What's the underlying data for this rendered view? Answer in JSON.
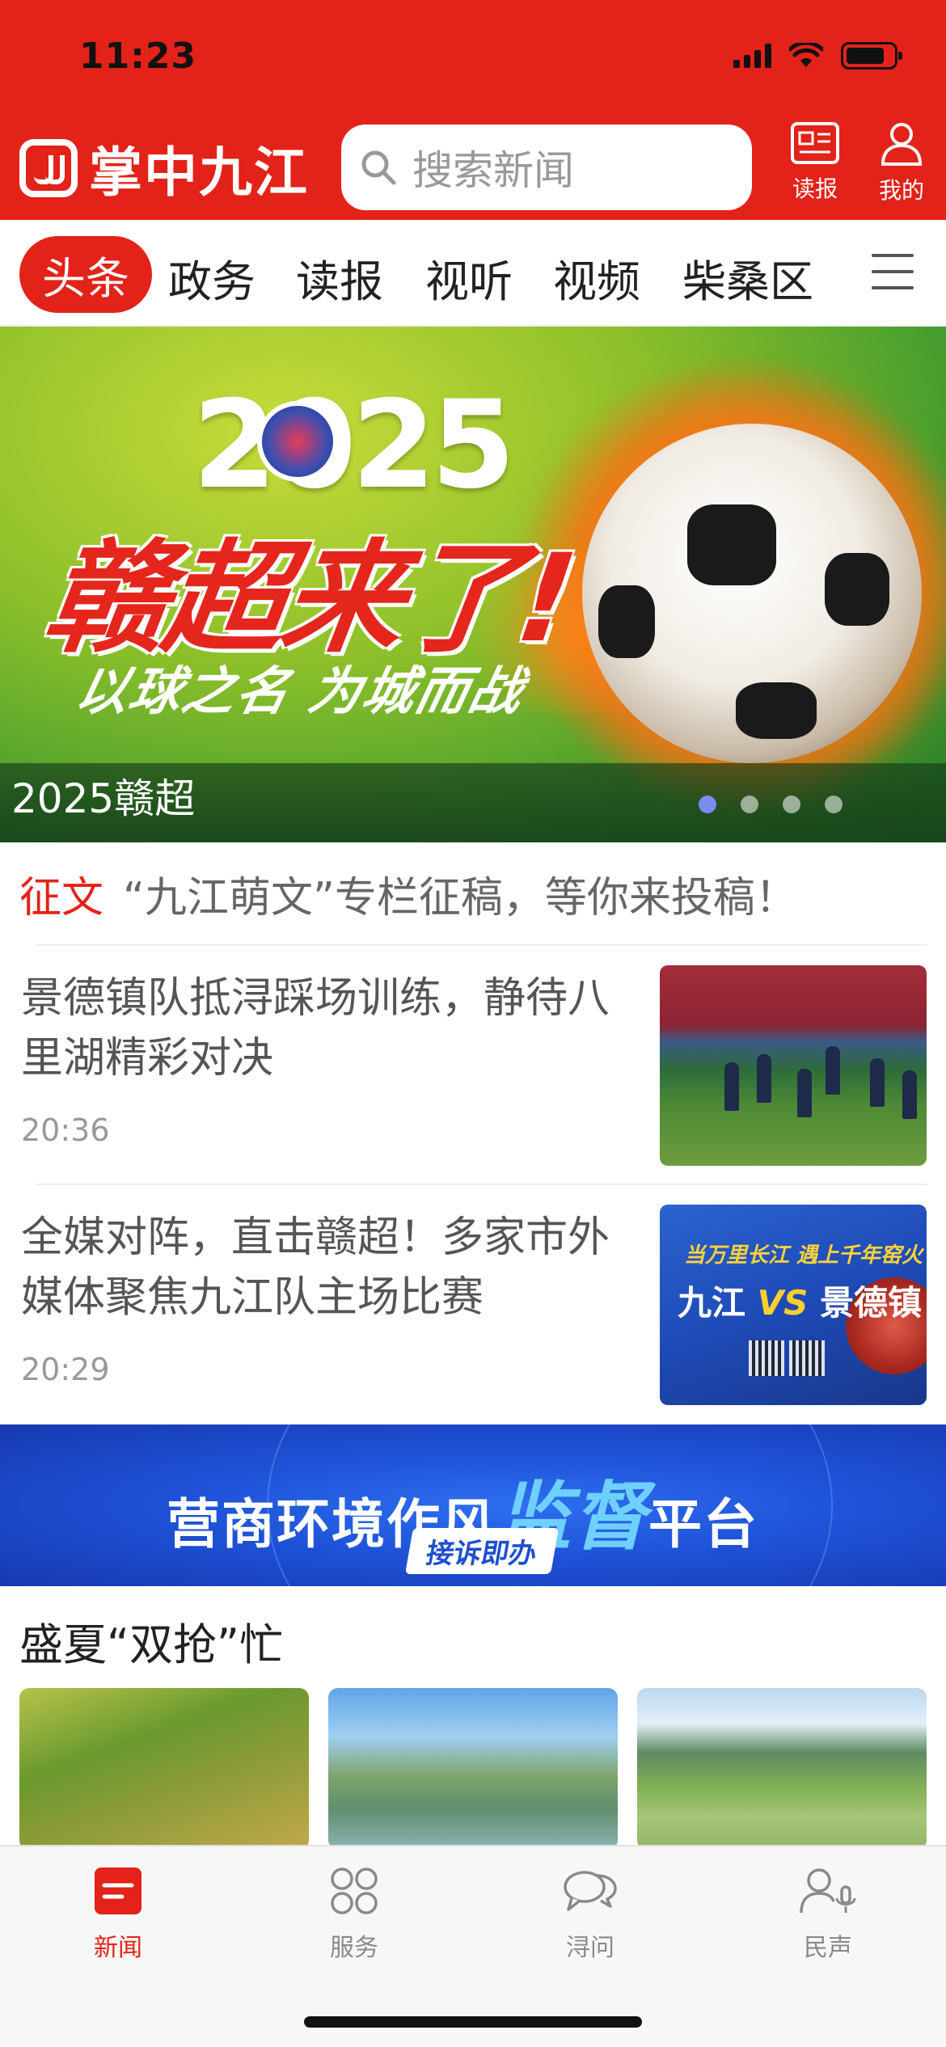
{
  "status_bar": {
    "time": "11:23"
  },
  "header": {
    "app_name": "掌中九江",
    "search_placeholder": "搜索新闻",
    "actions": [
      {
        "label": "读报",
        "icon": "newspaper-icon"
      },
      {
        "label": "我的",
        "icon": "user-icon"
      }
    ]
  },
  "category_tabs": [
    {
      "label": "头条",
      "active": true
    },
    {
      "label": "政务",
      "active": false
    },
    {
      "label": "读报",
      "active": false
    },
    {
      "label": "视听",
      "active": false
    },
    {
      "label": "视频",
      "active": false
    },
    {
      "label": "柴桑区",
      "active": false
    }
  ],
  "banner": {
    "year": "2025",
    "headline": "赣超来了!",
    "slogan": "以球之名 为城而战",
    "caption": "2025赣超",
    "slide_count": 4,
    "active_slide": 1
  },
  "essay_call": {
    "tag": "征文",
    "text": "“九江萌文”专栏征稿，等你来投稿！"
  },
  "news": [
    {
      "title": "景德镇队抵浔踩场训练，静待八里湖精彩对决",
      "time": "20:36"
    },
    {
      "title": "全媒对阵，直击赣超！多家市外媒体聚焦九江队主场比赛",
      "time": "20:29"
    }
  ],
  "poster": {
    "line1": "当万里长江 遇上千年窑火",
    "team_a": "九江",
    "vs": "VS",
    "team_b": "景德镇"
  },
  "promo": {
    "title_part1": "营商环境作风",
    "title_highlight": "监督",
    "title_part2": "平台",
    "subtitle": "接诉即办"
  },
  "section": {
    "title": "盛夏“双抢”忙"
  },
  "bottom_tabs": [
    {
      "label": "新闻",
      "icon": "news-icon",
      "active": true
    },
    {
      "label": "服务",
      "icon": "services-grid-icon",
      "active": false
    },
    {
      "label": "浔问",
      "icon": "chat-bubbles-icon",
      "active": false
    },
    {
      "label": "民声",
      "icon": "voice-user-icon",
      "active": false
    }
  ],
  "colors": {
    "brand_red": "#e32219",
    "active_dot": "#7b8cf5",
    "promo_blue": "#1f52d8"
  }
}
